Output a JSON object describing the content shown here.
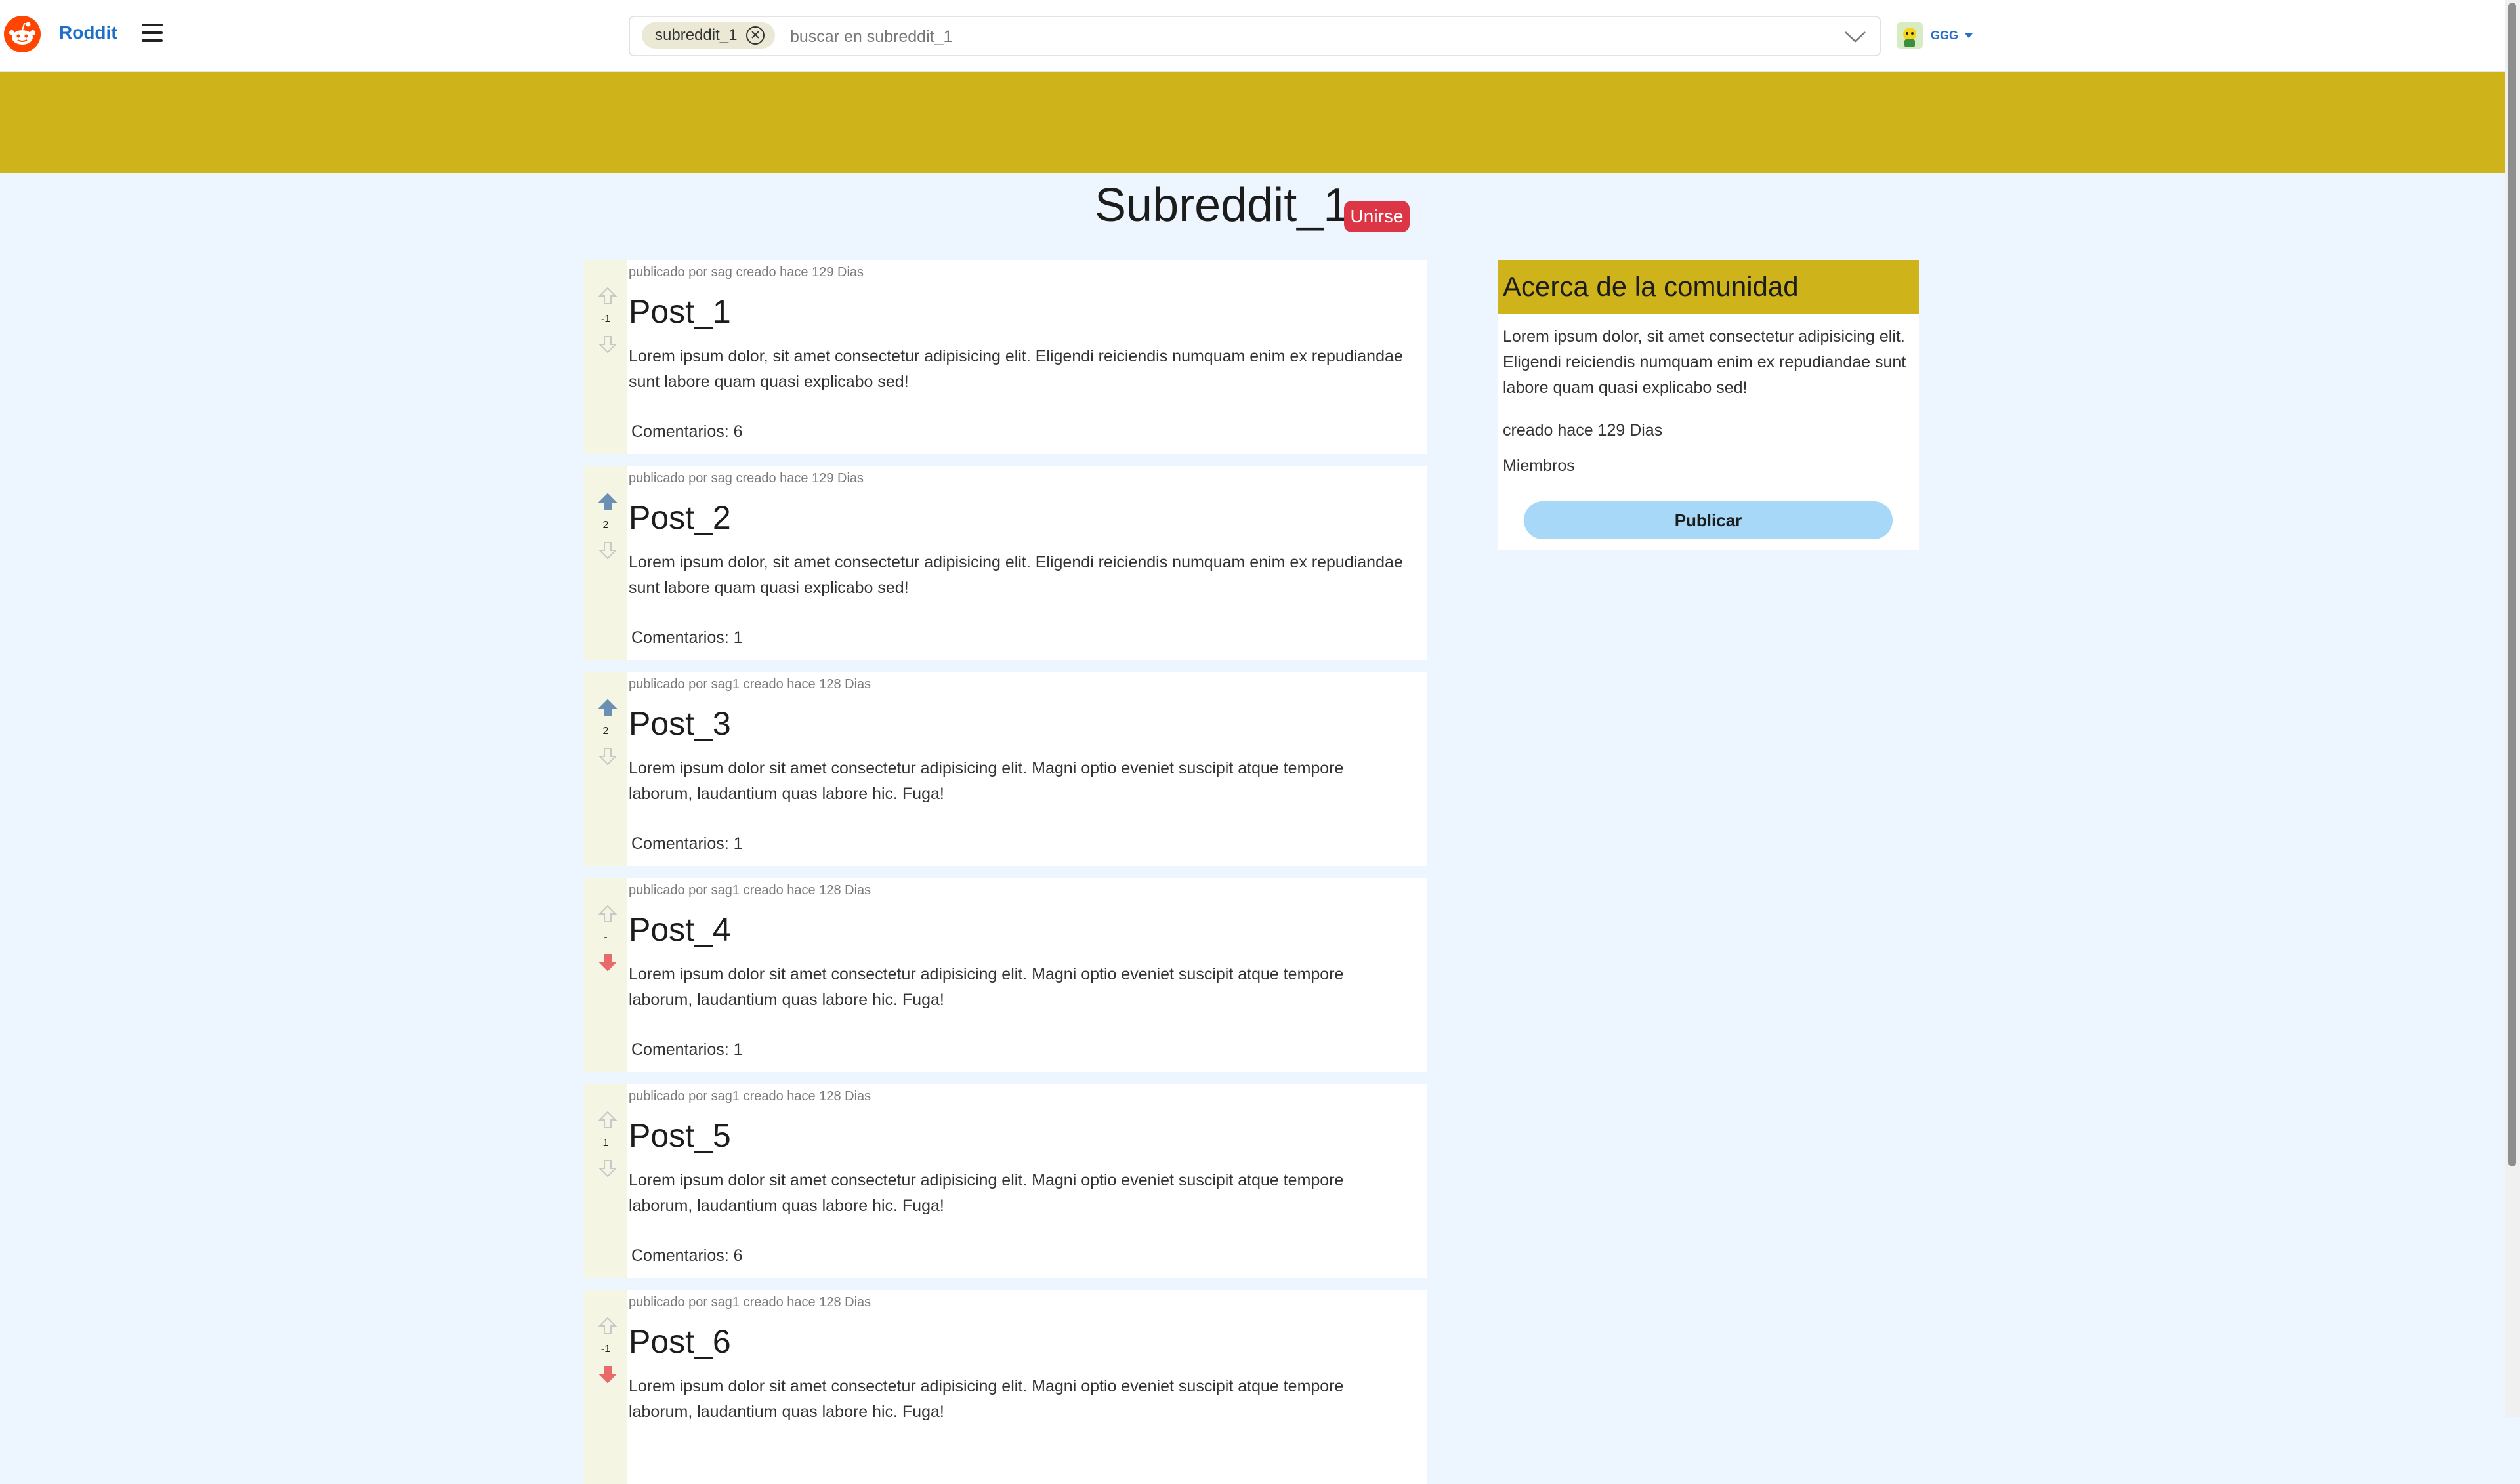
{
  "header": {
    "brand": "Roddit",
    "search": {
      "chip_label": "subreddit_1",
      "placeholder": "buscar en subreddit_1"
    },
    "user": {
      "name": "GGG"
    }
  },
  "community": {
    "title": "Subreddit_1",
    "join_label": "Unirse"
  },
  "posts": [
    {
      "meta": "publicado por sag creado hace 129 Dias",
      "title": "Post_1",
      "body": "Lorem ipsum dolor, sit amet consectetur adipisicing elit. Eligendi reiciendis numquam enim ex repudiandae sunt labore quam quasi explicabo sed!",
      "votes": "-1",
      "comments": "Comentarios: 6",
      "vote_state": "none"
    },
    {
      "meta": "publicado por sag creado hace 129 Dias",
      "title": "Post_2",
      "body": "Lorem ipsum dolor, sit amet consectetur adipisicing elit. Eligendi reiciendis numquam enim ex repudiandae sunt labore quam quasi explicabo sed!",
      "votes": "2",
      "comments": "Comentarios: 1",
      "vote_state": "up"
    },
    {
      "meta": "publicado por sag1 creado hace 128 Dias",
      "title": "Post_3",
      "body": "Lorem ipsum dolor sit amet consectetur adipisicing elit. Magni optio eveniet suscipit atque tempore laborum, laudantium quas labore hic. Fuga!",
      "votes": "2",
      "comments": "Comentarios: 1",
      "vote_state": "up"
    },
    {
      "meta": "publicado por sag1 creado hace 128 Dias",
      "title": "Post_4",
      "body": "Lorem ipsum dolor sit amet consectetur adipisicing elit. Magni optio eveniet suscipit atque tempore laborum, laudantium quas labore hic. Fuga!",
      "votes": "-",
      "comments": "Comentarios: 1",
      "vote_state": "down"
    },
    {
      "meta": "publicado por sag1 creado hace 128 Dias",
      "title": "Post_5",
      "body": "Lorem ipsum dolor sit amet consectetur adipisicing elit. Magni optio eveniet suscipit atque tempore laborum, laudantium quas labore hic. Fuga!",
      "votes": "1",
      "comments": "Comentarios: 6",
      "vote_state": "none"
    },
    {
      "meta": "publicado por sag1 creado hace 128 Dias",
      "title": "Post_6",
      "body": "Lorem ipsum dolor sit amet consectetur adipisicing elit. Magni optio eveniet suscipit atque tempore laborum, laudantium quas labore hic. Fuga!",
      "votes": "-1",
      "comments": "",
      "vote_state": "down"
    }
  ],
  "sidebar": {
    "title": "Acerca de la comunidad",
    "description": "Lorem ipsum dolor, sit amet consectetur adipisicing elit. Eligendi reiciendis numquam enim ex repudiandae sunt labore quam quasi explicabo sed!",
    "created": "creado hace 129 Dias",
    "members_label": "Miembros",
    "publish_label": "Publicar"
  },
  "colors": {
    "brand": "#1d6fc9",
    "banner": "#cfb31a",
    "page_background": "#edf5fe",
    "join": "#dc3545",
    "publish": "#a7d8f7",
    "upvote_active": "#6b8fb5",
    "downvote_active": "#e86a6a"
  },
  "icons": {
    "logo": "reddit-alien-icon",
    "menu": "hamburger-menu-icon",
    "chip_remove": "close-circle-icon",
    "search_dropdown": "chevron-down-icon",
    "upvote": "arrow-up-icon",
    "downvote": "arrow-down-icon"
  }
}
